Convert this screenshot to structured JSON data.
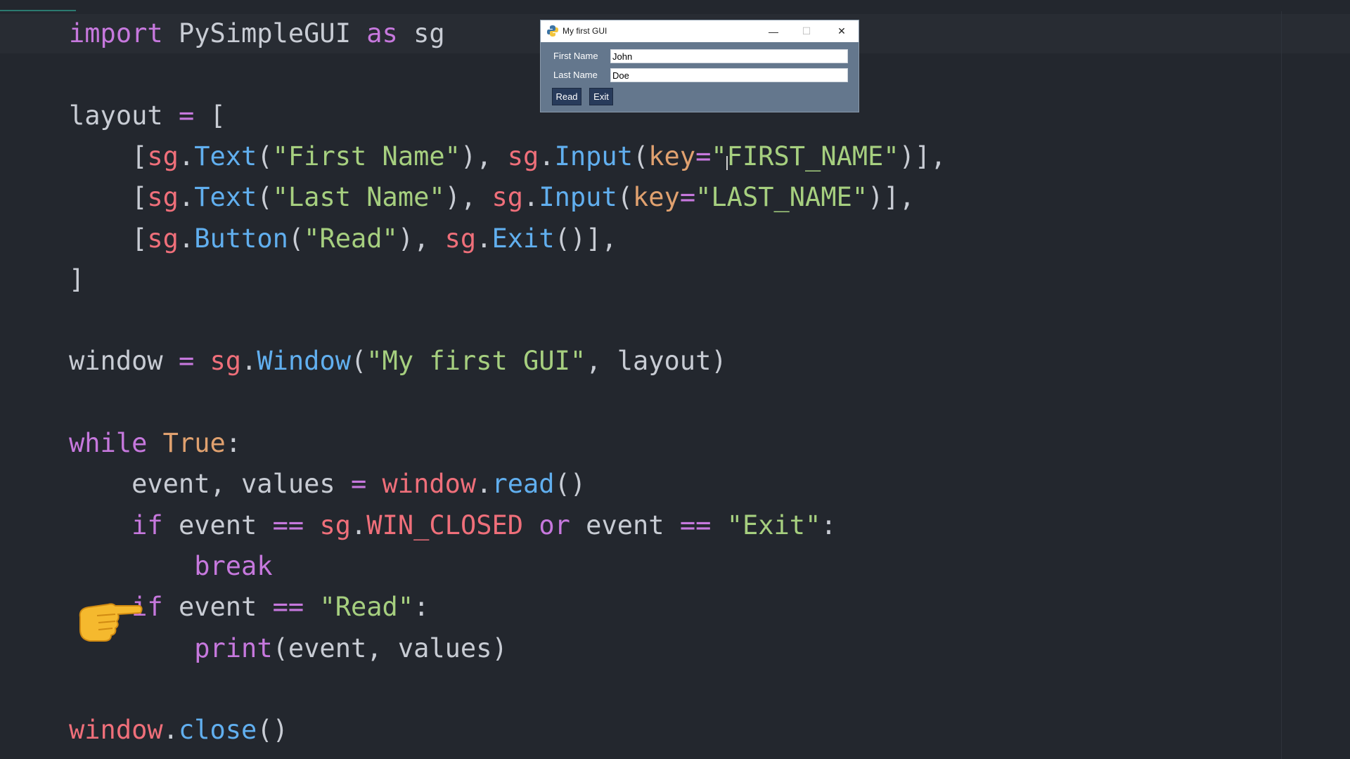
{
  "editor": {
    "lines": [
      [
        {
          "c": "kw",
          "t": "import"
        },
        {
          "c": "pl",
          "t": " PySimpleGUI "
        },
        {
          "c": "kw",
          "t": "as"
        },
        {
          "c": "pl",
          "t": " sg"
        }
      ],
      [],
      [
        {
          "c": "pl",
          "t": "layout "
        },
        {
          "c": "kw",
          "t": "="
        },
        {
          "c": "pl",
          "t": " ["
        }
      ],
      [
        {
          "c": "pl",
          "t": "    ["
        },
        {
          "c": "id",
          "t": "sg"
        },
        {
          "c": "pl",
          "t": "."
        },
        {
          "c": "fn",
          "t": "Text"
        },
        {
          "c": "pl",
          "t": "("
        },
        {
          "c": "str",
          "t": "\"First Name\""
        },
        {
          "c": "pl",
          "t": "), "
        },
        {
          "c": "id",
          "t": "sg"
        },
        {
          "c": "pl",
          "t": "."
        },
        {
          "c": "fn",
          "t": "Input"
        },
        {
          "c": "pl",
          "t": "("
        },
        {
          "c": "num",
          "t": "key"
        },
        {
          "c": "kw",
          "t": "="
        },
        {
          "c": "str",
          "t": "\"FIRST_NAME\""
        },
        {
          "c": "pl",
          "t": ")],"
        }
      ],
      [
        {
          "c": "pl",
          "t": "    ["
        },
        {
          "c": "id",
          "t": "sg"
        },
        {
          "c": "pl",
          "t": "."
        },
        {
          "c": "fn",
          "t": "Text"
        },
        {
          "c": "pl",
          "t": "("
        },
        {
          "c": "str",
          "t": "\"Last Name\""
        },
        {
          "c": "pl",
          "t": "), "
        },
        {
          "c": "id",
          "t": "sg"
        },
        {
          "c": "pl",
          "t": "."
        },
        {
          "c": "fn",
          "t": "Input"
        },
        {
          "c": "pl",
          "t": "("
        },
        {
          "c": "num",
          "t": "key"
        },
        {
          "c": "kw",
          "t": "="
        },
        {
          "c": "str",
          "t": "\"LAST_NAME\""
        },
        {
          "c": "pl",
          "t": ")],"
        }
      ],
      [
        {
          "c": "pl",
          "t": "    ["
        },
        {
          "c": "id",
          "t": "sg"
        },
        {
          "c": "pl",
          "t": "."
        },
        {
          "c": "fn",
          "t": "Button"
        },
        {
          "c": "pl",
          "t": "("
        },
        {
          "c": "str",
          "t": "\"Read\""
        },
        {
          "c": "pl",
          "t": "), "
        },
        {
          "c": "id",
          "t": "sg"
        },
        {
          "c": "pl",
          "t": "."
        },
        {
          "c": "fn",
          "t": "Exit"
        },
        {
          "c": "pl",
          "t": "()],"
        }
      ],
      [
        {
          "c": "pl",
          "t": "]"
        }
      ],
      [],
      [
        {
          "c": "pl",
          "t": "window "
        },
        {
          "c": "kw",
          "t": "="
        },
        {
          "c": "pl",
          "t": " "
        },
        {
          "c": "id",
          "t": "sg"
        },
        {
          "c": "pl",
          "t": "."
        },
        {
          "c": "fn",
          "t": "Window"
        },
        {
          "c": "pl",
          "t": "("
        },
        {
          "c": "str",
          "t": "\"My first GUI\""
        },
        {
          "c": "pl",
          "t": ", layout)"
        }
      ],
      [],
      [
        {
          "c": "kw",
          "t": "while"
        },
        {
          "c": "pl",
          "t": " "
        },
        {
          "c": "num",
          "t": "True"
        },
        {
          "c": "pl",
          "t": ":"
        }
      ],
      [
        {
          "c": "pl",
          "t": "    event, values "
        },
        {
          "c": "kw",
          "t": "="
        },
        {
          "c": "pl",
          "t": " "
        },
        {
          "c": "id",
          "t": "window"
        },
        {
          "c": "pl",
          "t": "."
        },
        {
          "c": "fn",
          "t": "read"
        },
        {
          "c": "pl",
          "t": "()"
        }
      ],
      [
        {
          "c": "pl",
          "t": "    "
        },
        {
          "c": "kw",
          "t": "if"
        },
        {
          "c": "pl",
          "t": " event "
        },
        {
          "c": "kw",
          "t": "=="
        },
        {
          "c": "pl",
          "t": " "
        },
        {
          "c": "id",
          "t": "sg"
        },
        {
          "c": "pl",
          "t": "."
        },
        {
          "c": "id",
          "t": "WIN_CLOSED"
        },
        {
          "c": "pl",
          "t": " "
        },
        {
          "c": "kw",
          "t": "or"
        },
        {
          "c": "pl",
          "t": " event "
        },
        {
          "c": "kw",
          "t": "=="
        },
        {
          "c": "pl",
          "t": " "
        },
        {
          "c": "str",
          "t": "\"Exit\""
        },
        {
          "c": "pl",
          "t": ":"
        }
      ],
      [
        {
          "c": "pl",
          "t": "        "
        },
        {
          "c": "kw",
          "t": "break"
        }
      ],
      [
        {
          "c": "pl",
          "t": "    "
        },
        {
          "c": "kw",
          "t": "if"
        },
        {
          "c": "pl",
          "t": " event "
        },
        {
          "c": "kw",
          "t": "=="
        },
        {
          "c": "pl",
          "t": " "
        },
        {
          "c": "str",
          "t": "\"Read\""
        },
        {
          "c": "pl",
          "t": ":"
        }
      ],
      [
        {
          "c": "pl",
          "t": "        "
        },
        {
          "c": "kw",
          "t": "print"
        },
        {
          "c": "pl",
          "t": "(event, values)"
        }
      ],
      [],
      [
        {
          "c": "id",
          "t": "window"
        },
        {
          "c": "pl",
          "t": "."
        },
        {
          "c": "fn",
          "t": "close"
        },
        {
          "c": "pl",
          "t": "()"
        }
      ]
    ]
  },
  "gui": {
    "title": "My first GUI",
    "minimize_glyph": "—",
    "maximize_glyph": "☐",
    "close_glyph": "✕",
    "first_name_label": "First Name",
    "first_name_value": "John",
    "last_name_label": "Last Name",
    "last_name_value": "Doe",
    "read_label": "Read",
    "exit_label": "Exit",
    "icon": "python-icon"
  },
  "colors": {
    "background": "#23272e",
    "keyword": "#c678dd",
    "identifier": "#ef6f7a",
    "function": "#61afef",
    "string": "#a6cf7f",
    "number": "#e0a16f",
    "window_bg": "#64778d",
    "button_bg": "#283b5b"
  },
  "overlay": {
    "icon": "pointing-hand-icon"
  }
}
